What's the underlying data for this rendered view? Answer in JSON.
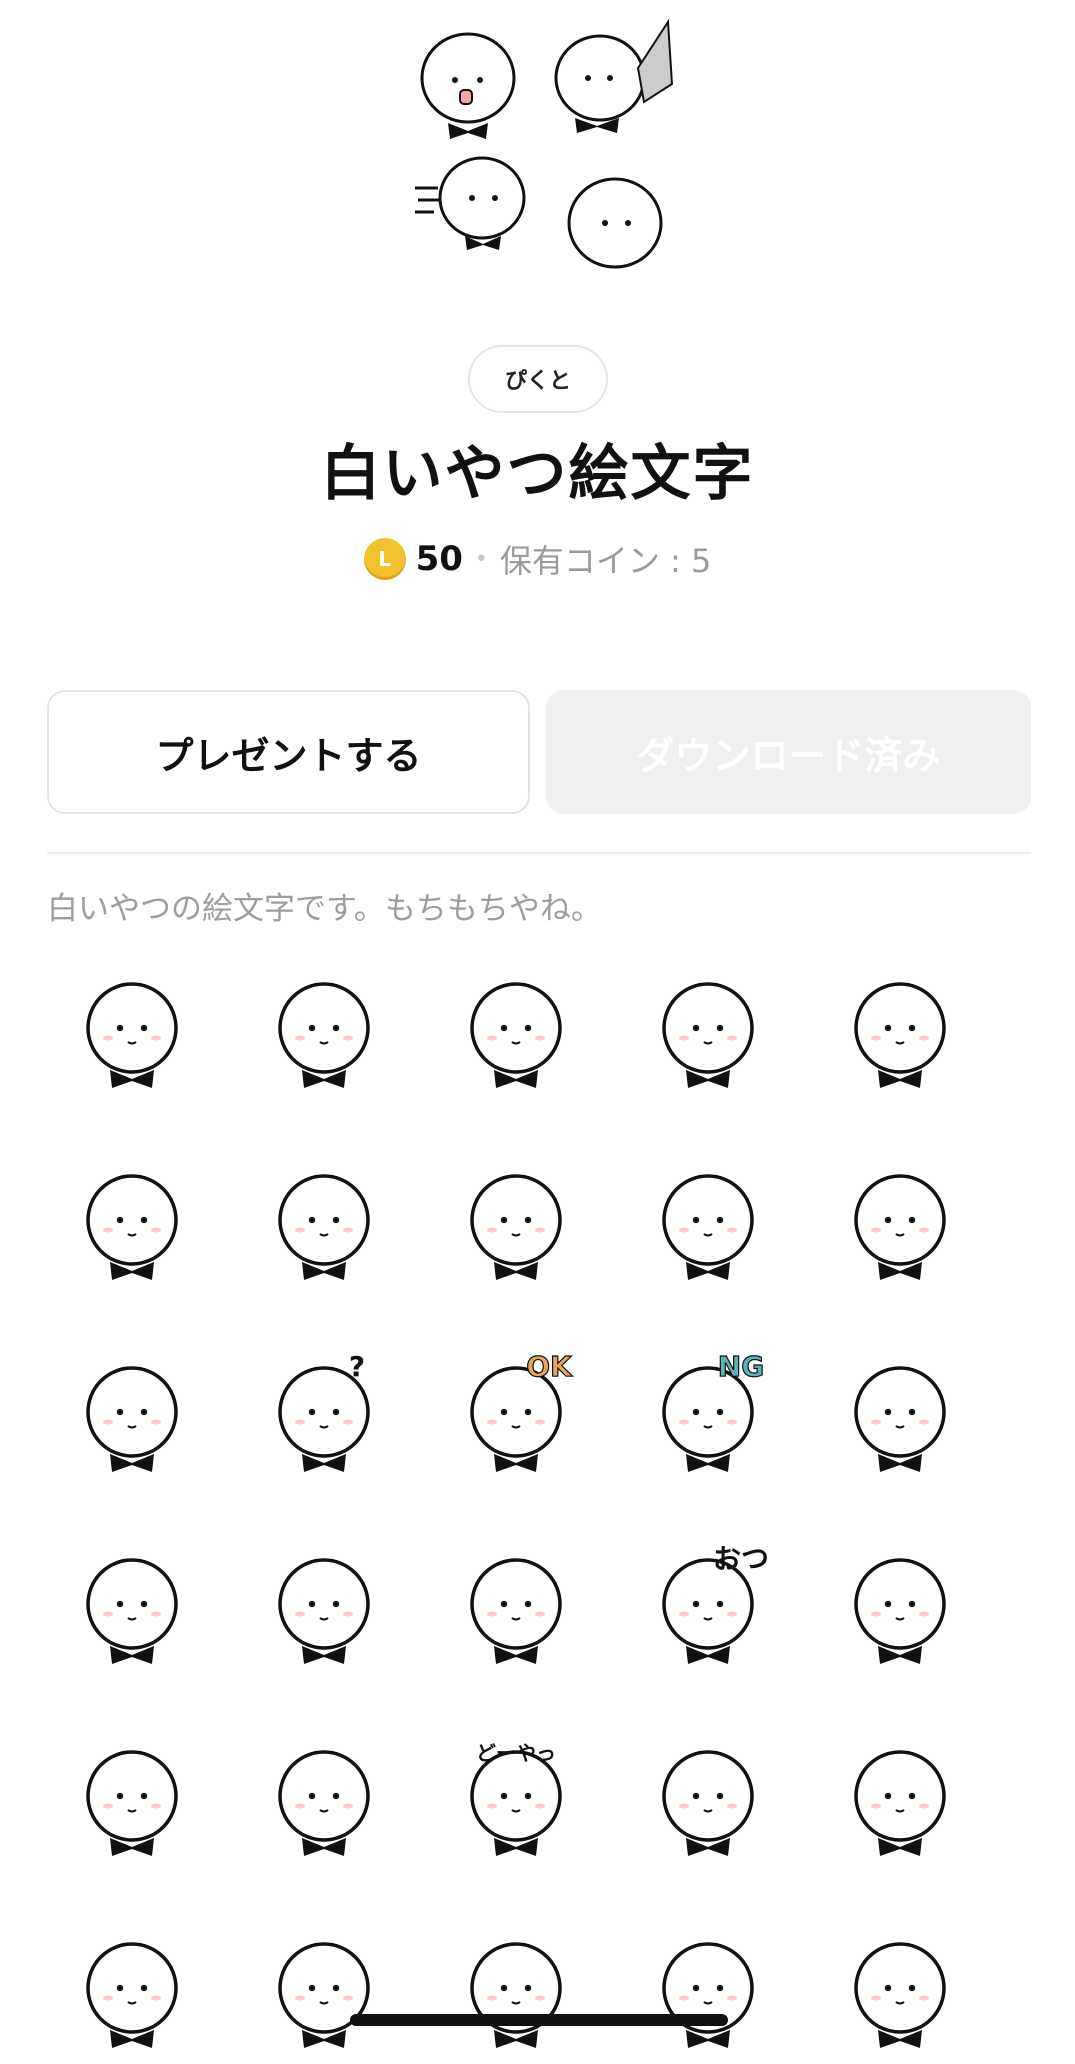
{
  "sticker": {
    "author": "ぴくと",
    "title": "白いやつ絵文字",
    "coin_glyph": "L",
    "price": "50",
    "separator": "•",
    "owned_coins": "保有コイン : 5"
  },
  "actions": {
    "present_label": "プレゼントする",
    "downloaded_label": "ダウンロード済み"
  },
  "description": "白いやつの絵文字です。もちもちやね。",
  "colors": {
    "coin": "#f2c12e",
    "accent_blush": "#f4a7a7",
    "ok_text": "#e6a65a",
    "ng_text": "#5bb3b8"
  },
  "emoji_grid": {
    "rows": 6,
    "columns": 5,
    "items": [
      {
        "icon": "face-neutral-icon"
      },
      {
        "icon": "face-wink-icon"
      },
      {
        "icon": "face-happy-sparkle-icon"
      },
      {
        "icon": "face-sweat-icon"
      },
      {
        "icon": "face-grumpy-icon"
      },
      {
        "icon": "face-singing-icon"
      },
      {
        "icon": "face-thinking-icon"
      },
      {
        "icon": "face-surprised-icon"
      },
      {
        "icon": "face-heart-eyes-icon"
      },
      {
        "icon": "face-raised-hand-icon"
      },
      {
        "icon": "face-sleepy-icon"
      },
      {
        "icon": "face-question-icon",
        "text": "?"
      },
      {
        "icon": "face-ok-icon",
        "text": "OK"
      },
      {
        "icon": "face-ng-icon",
        "text": "NG"
      },
      {
        "icon": "face-peeking-icon"
      },
      {
        "icon": "face-thumbs-up-icon"
      },
      {
        "icon": "face-sunglasses-icon"
      },
      {
        "icon": "face-mochi-icon"
      },
      {
        "icon": "face-otsu-icon",
        "text": "おつ"
      },
      {
        "icon": "face-running-icon"
      },
      {
        "icon": "face-tongue-icon"
      },
      {
        "icon": "face-knife-icon"
      },
      {
        "icon": "face-doya-icon",
        "text": "どーやっ"
      },
      {
        "icon": "face-dizzy-icon"
      },
      {
        "icon": "face-angry-icon"
      },
      {
        "icon": "face-lying-icon"
      },
      {
        "icon": "face-cat-ride-icon"
      },
      {
        "icon": "face-cat-hug-icon"
      },
      {
        "icon": "face-car-icon"
      },
      {
        "icon": "face-sad-icon"
      }
    ]
  }
}
